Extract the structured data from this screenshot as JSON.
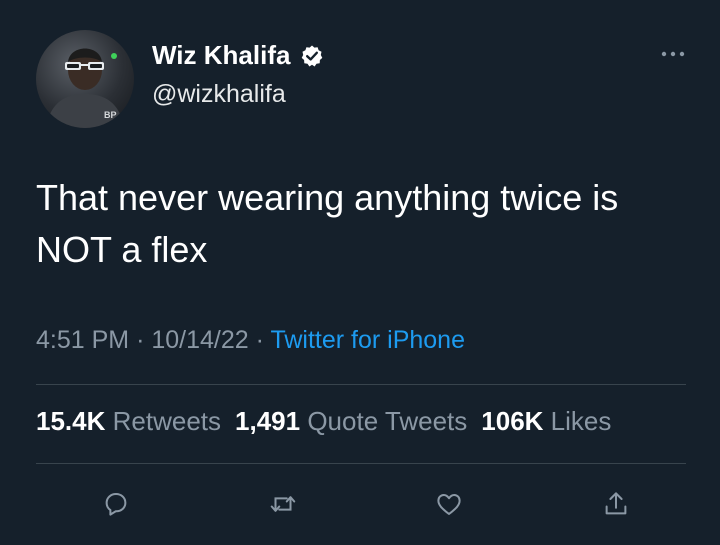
{
  "author": {
    "display_name": "Wiz Khalifa",
    "handle": "@wizkhalifa",
    "verified": true,
    "avatar_badge": "BP"
  },
  "tweet": {
    "text": "That never wearing anything twice is\nNOT a flex",
    "time": "4:51 PM",
    "date": "10/14/22",
    "source": "Twitter for iPhone",
    "separator": "·"
  },
  "stats": {
    "retweets_count": "15.4K",
    "retweets_label": "Retweets",
    "quotes_count": "1,491",
    "quotes_label": "Quote Tweets",
    "likes_count": "106K",
    "likes_label": "Likes"
  },
  "actions": [
    "reply-icon",
    "retweet-icon",
    "like-icon",
    "share-icon"
  ],
  "colors": {
    "background": "#15202b",
    "text": "#ffffff",
    "secondary": "#8b98a5",
    "link": "#1d9bf0",
    "verified": "#1d9bf0",
    "divider": "#38444d"
  }
}
